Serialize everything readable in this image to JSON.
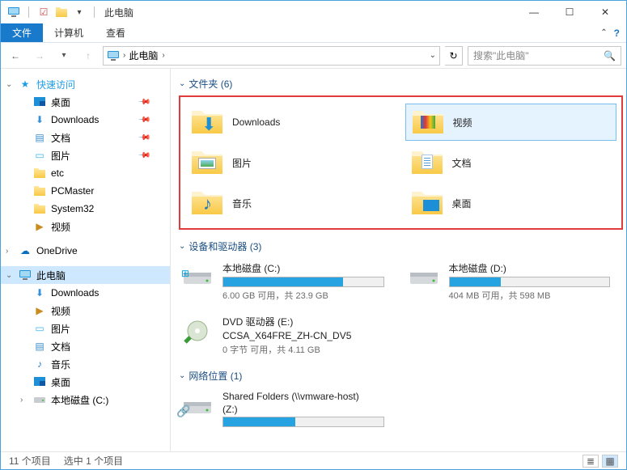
{
  "window": {
    "title": "此电脑"
  },
  "ribbon": {
    "file": "文件",
    "tab_computer": "计算机",
    "tab_view": "查看"
  },
  "address": {
    "location": "此电脑",
    "search_placeholder": "搜索\"此电脑\""
  },
  "nav": {
    "quick_access": "快速访问",
    "quick_items": [
      {
        "label": "桌面",
        "icon": "desktop"
      },
      {
        "label": "Downloads",
        "icon": "downloads"
      },
      {
        "label": "文档",
        "icon": "documents"
      },
      {
        "label": "图片",
        "icon": "pictures"
      },
      {
        "label": "etc",
        "icon": "folder"
      },
      {
        "label": "PCMaster",
        "icon": "folder"
      },
      {
        "label": "System32",
        "icon": "folder"
      },
      {
        "label": "视频",
        "icon": "videos"
      }
    ],
    "onedrive": "OneDrive",
    "this_pc": "此电脑",
    "pc_items": [
      {
        "label": "Downloads",
        "icon": "downloads"
      },
      {
        "label": "视频",
        "icon": "videos"
      },
      {
        "label": "图片",
        "icon": "pictures"
      },
      {
        "label": "文档",
        "icon": "documents"
      },
      {
        "label": "音乐",
        "icon": "music"
      },
      {
        "label": "桌面",
        "icon": "desktop"
      },
      {
        "label": "本地磁盘 (C:)",
        "icon": "drive"
      }
    ]
  },
  "content": {
    "section_folders": "文件夹 (6)",
    "folders": [
      {
        "label": "Downloads",
        "type": "downloads"
      },
      {
        "label": "视频",
        "type": "videos",
        "selected": true
      },
      {
        "label": "图片",
        "type": "pictures"
      },
      {
        "label": "文档",
        "type": "documents"
      },
      {
        "label": "音乐",
        "type": "music"
      },
      {
        "label": "桌面",
        "type": "desktop"
      }
    ],
    "section_drives": "设备和驱动器 (3)",
    "drives": [
      {
        "name": "本地磁盘 (C:)",
        "stat": "6.00 GB 可用，共 23.9 GB",
        "fill": 75,
        "icon": "win-drive"
      },
      {
        "name": "本地磁盘 (D:)",
        "stat": "404 MB 可用，共 598 MB",
        "fill": 32,
        "icon": "drive"
      },
      {
        "name": "DVD 驱动器 (E:)",
        "name2": "CCSA_X64FRE_ZH-CN_DV5",
        "stat": "0 字节 可用，共 4.11 GB",
        "icon": "dvd"
      }
    ],
    "section_network": "网络位置 (1)",
    "network": [
      {
        "name": "Shared Folders (\\\\vmware-host)",
        "name2": "(Z:)",
        "fill": 45
      }
    ]
  },
  "status": {
    "items": "11 个项目",
    "selected": "选中 1 个项目"
  }
}
